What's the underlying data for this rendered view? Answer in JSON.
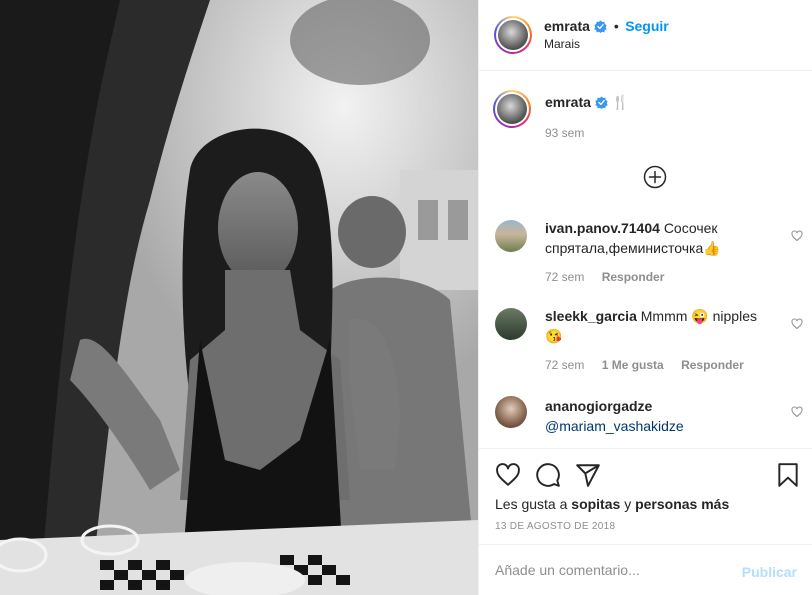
{
  "post": {
    "username": "emrata",
    "follow_label": "Seguir",
    "separator": "•",
    "location": "Marais"
  },
  "caption": {
    "username": "emrata",
    "emoji": "🍴",
    "time": "93 sem"
  },
  "comments": [
    {
      "username": "ivan.panov.71404",
      "text": "Сосочек спрятала,феминисточка👍",
      "time": "72 sem",
      "reply_label": "Responder"
    },
    {
      "username": "sleekk_garcia",
      "text": "Mmmm 😜 nipples 😘",
      "time": "72 sem",
      "likes_label": "1 Me gusta",
      "reply_label": "Responder"
    },
    {
      "username": "ananogiorgadze",
      "mention": "@mariam_vashakidze"
    }
  ],
  "likes": {
    "prefix": "Les gusta a",
    "user": "sopitas",
    "joiner": "y",
    "others": "personas más"
  },
  "date": "13 DE AGOSTO DE 2018",
  "add_comment": {
    "placeholder": "Añade un comentario...",
    "publish_label": "Publicar"
  },
  "icons": {
    "verified": "verified-badge-icon",
    "load_more": "plus-circle-icon",
    "like": "heart-icon",
    "comment": "comment-bubble-icon",
    "share": "paper-plane-icon",
    "save": "bookmark-icon"
  },
  "colors": {
    "accent": "#0095f6",
    "verified": "#3897f0",
    "publish_disabled": "#b2dffc",
    "muted": "#8e8e8e",
    "text": "#262626"
  }
}
